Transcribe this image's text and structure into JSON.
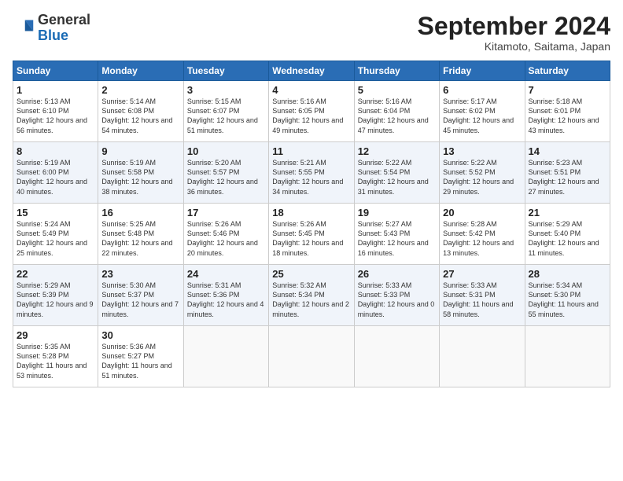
{
  "header": {
    "logo_general": "General",
    "logo_blue": "Blue",
    "month": "September 2024",
    "location": "Kitamoto, Saitama, Japan"
  },
  "days_of_week": [
    "Sunday",
    "Monday",
    "Tuesday",
    "Wednesday",
    "Thursday",
    "Friday",
    "Saturday"
  ],
  "rows": [
    [
      {
        "day": "1",
        "sunrise": "Sunrise: 5:13 AM",
        "sunset": "Sunset: 6:10 PM",
        "daylight": "Daylight: 12 hours and 56 minutes."
      },
      {
        "day": "2",
        "sunrise": "Sunrise: 5:14 AM",
        "sunset": "Sunset: 6:08 PM",
        "daylight": "Daylight: 12 hours and 54 minutes."
      },
      {
        "day": "3",
        "sunrise": "Sunrise: 5:15 AM",
        "sunset": "Sunset: 6:07 PM",
        "daylight": "Daylight: 12 hours and 51 minutes."
      },
      {
        "day": "4",
        "sunrise": "Sunrise: 5:16 AM",
        "sunset": "Sunset: 6:05 PM",
        "daylight": "Daylight: 12 hours and 49 minutes."
      },
      {
        "day": "5",
        "sunrise": "Sunrise: 5:16 AM",
        "sunset": "Sunset: 6:04 PM",
        "daylight": "Daylight: 12 hours and 47 minutes."
      },
      {
        "day": "6",
        "sunrise": "Sunrise: 5:17 AM",
        "sunset": "Sunset: 6:02 PM",
        "daylight": "Daylight: 12 hours and 45 minutes."
      },
      {
        "day": "7",
        "sunrise": "Sunrise: 5:18 AM",
        "sunset": "Sunset: 6:01 PM",
        "daylight": "Daylight: 12 hours and 43 minutes."
      }
    ],
    [
      {
        "day": "8",
        "sunrise": "Sunrise: 5:19 AM",
        "sunset": "Sunset: 6:00 PM",
        "daylight": "Daylight: 12 hours and 40 minutes."
      },
      {
        "day": "9",
        "sunrise": "Sunrise: 5:19 AM",
        "sunset": "Sunset: 5:58 PM",
        "daylight": "Daylight: 12 hours and 38 minutes."
      },
      {
        "day": "10",
        "sunrise": "Sunrise: 5:20 AM",
        "sunset": "Sunset: 5:57 PM",
        "daylight": "Daylight: 12 hours and 36 minutes."
      },
      {
        "day": "11",
        "sunrise": "Sunrise: 5:21 AM",
        "sunset": "Sunset: 5:55 PM",
        "daylight": "Daylight: 12 hours and 34 minutes."
      },
      {
        "day": "12",
        "sunrise": "Sunrise: 5:22 AM",
        "sunset": "Sunset: 5:54 PM",
        "daylight": "Daylight: 12 hours and 31 minutes."
      },
      {
        "day": "13",
        "sunrise": "Sunrise: 5:22 AM",
        "sunset": "Sunset: 5:52 PM",
        "daylight": "Daylight: 12 hours and 29 minutes."
      },
      {
        "day": "14",
        "sunrise": "Sunrise: 5:23 AM",
        "sunset": "Sunset: 5:51 PM",
        "daylight": "Daylight: 12 hours and 27 minutes."
      }
    ],
    [
      {
        "day": "15",
        "sunrise": "Sunrise: 5:24 AM",
        "sunset": "Sunset: 5:49 PM",
        "daylight": "Daylight: 12 hours and 25 minutes."
      },
      {
        "day": "16",
        "sunrise": "Sunrise: 5:25 AM",
        "sunset": "Sunset: 5:48 PM",
        "daylight": "Daylight: 12 hours and 22 minutes."
      },
      {
        "day": "17",
        "sunrise": "Sunrise: 5:26 AM",
        "sunset": "Sunset: 5:46 PM",
        "daylight": "Daylight: 12 hours and 20 minutes."
      },
      {
        "day": "18",
        "sunrise": "Sunrise: 5:26 AM",
        "sunset": "Sunset: 5:45 PM",
        "daylight": "Daylight: 12 hours and 18 minutes."
      },
      {
        "day": "19",
        "sunrise": "Sunrise: 5:27 AM",
        "sunset": "Sunset: 5:43 PM",
        "daylight": "Daylight: 12 hours and 16 minutes."
      },
      {
        "day": "20",
        "sunrise": "Sunrise: 5:28 AM",
        "sunset": "Sunset: 5:42 PM",
        "daylight": "Daylight: 12 hours and 13 minutes."
      },
      {
        "day": "21",
        "sunrise": "Sunrise: 5:29 AM",
        "sunset": "Sunset: 5:40 PM",
        "daylight": "Daylight: 12 hours and 11 minutes."
      }
    ],
    [
      {
        "day": "22",
        "sunrise": "Sunrise: 5:29 AM",
        "sunset": "Sunset: 5:39 PM",
        "daylight": "Daylight: 12 hours and 9 minutes."
      },
      {
        "day": "23",
        "sunrise": "Sunrise: 5:30 AM",
        "sunset": "Sunset: 5:37 PM",
        "daylight": "Daylight: 12 hours and 7 minutes."
      },
      {
        "day": "24",
        "sunrise": "Sunrise: 5:31 AM",
        "sunset": "Sunset: 5:36 PM",
        "daylight": "Daylight: 12 hours and 4 minutes."
      },
      {
        "day": "25",
        "sunrise": "Sunrise: 5:32 AM",
        "sunset": "Sunset: 5:34 PM",
        "daylight": "Daylight: 12 hours and 2 minutes."
      },
      {
        "day": "26",
        "sunrise": "Sunrise: 5:33 AM",
        "sunset": "Sunset: 5:33 PM",
        "daylight": "Daylight: 12 hours and 0 minutes."
      },
      {
        "day": "27",
        "sunrise": "Sunrise: 5:33 AM",
        "sunset": "Sunset: 5:31 PM",
        "daylight": "Daylight: 11 hours and 58 minutes."
      },
      {
        "day": "28",
        "sunrise": "Sunrise: 5:34 AM",
        "sunset": "Sunset: 5:30 PM",
        "daylight": "Daylight: 11 hours and 55 minutes."
      }
    ],
    [
      {
        "day": "29",
        "sunrise": "Sunrise: 5:35 AM",
        "sunset": "Sunset: 5:28 PM",
        "daylight": "Daylight: 11 hours and 53 minutes."
      },
      {
        "day": "30",
        "sunrise": "Sunrise: 5:36 AM",
        "sunset": "Sunset: 5:27 PM",
        "daylight": "Daylight: 11 hours and 51 minutes."
      },
      null,
      null,
      null,
      null,
      null
    ]
  ]
}
